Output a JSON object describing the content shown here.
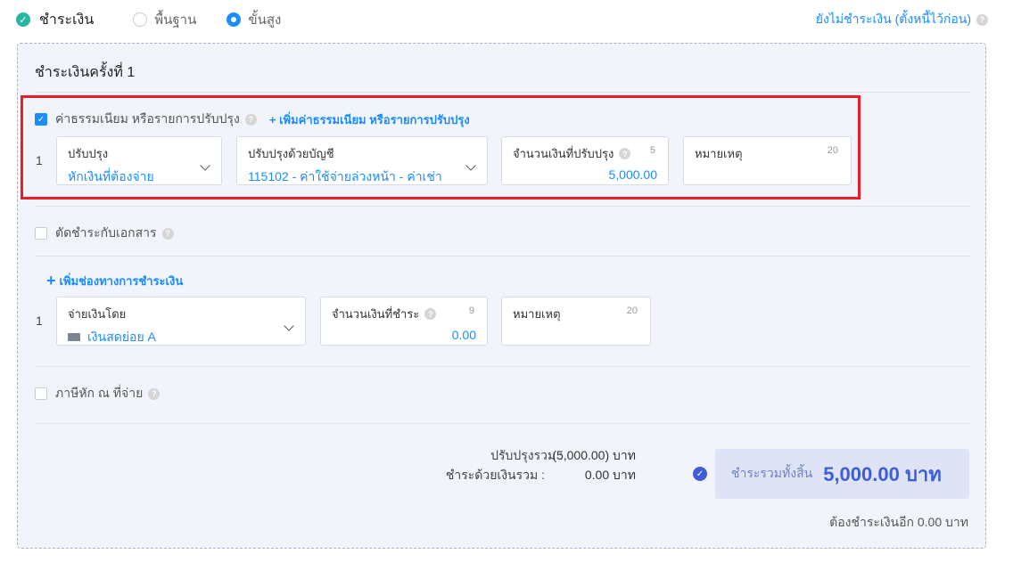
{
  "topbar": {
    "pay_label": "ชำระเงิน",
    "options": [
      "พื้นฐาน",
      "ขั้นสูง"
    ],
    "selected": "ขั้นสูง",
    "unpaid_link": "ยังไม่ชำระเงิน (ตั้งหนี้ไว้ก่อน)"
  },
  "panel": {
    "title": "ชำระเงินครั้งที่ 1",
    "fees": {
      "label": "ค่าธรรมเนียม หรือรายการปรับปรุง",
      "add_label": "+ เพิ่มค่าธรรมเนียม หรือรายการปรับปรุง",
      "row_index": "1",
      "adjust_label": "ปรับปรุง",
      "adjust_value": "หักเงินที่ต้องจ่าย",
      "account_label": "ปรับปรุงด้วยบัญชี",
      "account_value": "115102 - ค่าใช้จ่ายล่วงหน้า - ค่าเช่า",
      "amount_label": "จำนวนเงินที่ปรับปรุง",
      "amount_count": "5",
      "amount_value": "5,000.00",
      "note_label": "หมายเหตุ",
      "note_count": "20"
    },
    "settle_doc_label": "ตัดชำระกับเอกสาร",
    "payment": {
      "add_label": "เพิ่มช่องทางการชำระเงิน",
      "row_index": "1",
      "payby_label": "จ่ายเงินโดย",
      "payby_value": "เงินสดย่อย A",
      "amount_label": "จำนวนเงินที่ชำระ",
      "amount_count": "9",
      "amount_value": "0.00",
      "note_label": "หมายเหตุ",
      "note_count": "20"
    },
    "withholding_label": "ภาษีหัก ณ ที่จ่าย",
    "summary": {
      "adjust_total_label": "ปรับปรุงรวม :",
      "adjust_total_value": "(5,000.00) บาท",
      "paid_total_label": "ชำระด้วยเงินรวม :",
      "paid_total_value": "0.00 บาท",
      "grand_label": "ชำระรวมทั้งสิ้น",
      "grand_value": "5,000.00 บาท",
      "remaining": "ต้องชำระเงินอีก 0.00 บาท"
    }
  }
}
